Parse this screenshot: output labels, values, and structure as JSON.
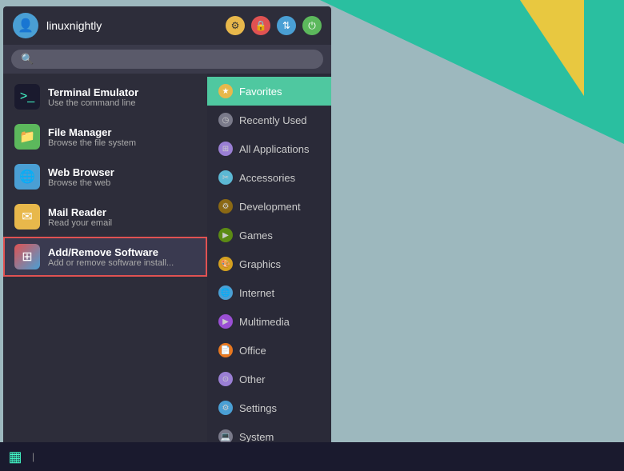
{
  "header": {
    "username": "linuxnightly",
    "icons": {
      "star": "⚙",
      "lock": "🔒",
      "transfer": "⇅",
      "power": "⏻"
    }
  },
  "search": {
    "placeholder": ""
  },
  "apps": [
    {
      "id": "terminal",
      "name": "Terminal Emulator",
      "desc": "Use the command line",
      "icon_type": "terminal",
      "icon_sym": ">_",
      "active": false
    },
    {
      "id": "filemanager",
      "name": "File Manager",
      "desc": "Browse the file system",
      "icon_type": "files",
      "icon_sym": "📁",
      "active": false
    },
    {
      "id": "browser",
      "name": "Web Browser",
      "desc": "Browse the web",
      "icon_type": "browser",
      "icon_sym": "🌐",
      "active": false
    },
    {
      "id": "mail",
      "name": "Mail Reader",
      "desc": "Read your email",
      "icon_type": "mail",
      "icon_sym": "✉",
      "active": false
    },
    {
      "id": "addremove",
      "name": "Add/Remove Software",
      "desc": "Add or remove software install...",
      "icon_type": "addremove",
      "icon_sym": "⊞",
      "active": true
    }
  ],
  "categories": [
    {
      "id": "favorites",
      "label": "Favorites",
      "icon_type": "fav",
      "icon_sym": "★",
      "active": true
    },
    {
      "id": "recently-used",
      "label": "Recently Used",
      "icon_type": "recent",
      "icon_sym": "◷",
      "active": false
    },
    {
      "id": "all-applications",
      "label": "All Applications",
      "icon_type": "all",
      "icon_sym": "⊞",
      "active": false
    },
    {
      "id": "accessories",
      "label": "Accessories",
      "icon_type": "accessories",
      "icon_sym": "✂",
      "active": false
    },
    {
      "id": "development",
      "label": "Development",
      "icon_type": "dev",
      "icon_sym": "⚙",
      "active": false
    },
    {
      "id": "games",
      "label": "Games",
      "icon_type": "games",
      "icon_sym": "🎮",
      "active": false
    },
    {
      "id": "graphics",
      "label": "Graphics",
      "icon_type": "graphics",
      "icon_sym": "🎨",
      "active": false
    },
    {
      "id": "internet",
      "label": "Internet",
      "icon_type": "internet",
      "icon_sym": "🌐",
      "active": false
    },
    {
      "id": "multimedia",
      "label": "Multimedia",
      "icon_type": "multimedia",
      "icon_sym": "▶",
      "active": false
    },
    {
      "id": "office",
      "label": "Office",
      "icon_type": "office",
      "icon_sym": "📄",
      "active": false
    },
    {
      "id": "other",
      "label": "Other",
      "icon_type": "other",
      "icon_sym": "⊙",
      "active": false
    },
    {
      "id": "settings",
      "label": "Settings",
      "icon_type": "settings",
      "icon_sym": "⚙",
      "active": false
    },
    {
      "id": "system",
      "label": "System",
      "icon_type": "system",
      "icon_sym": "💻",
      "active": false
    }
  ],
  "taskbar": {
    "icon_sym": "▦",
    "separator": "|"
  }
}
